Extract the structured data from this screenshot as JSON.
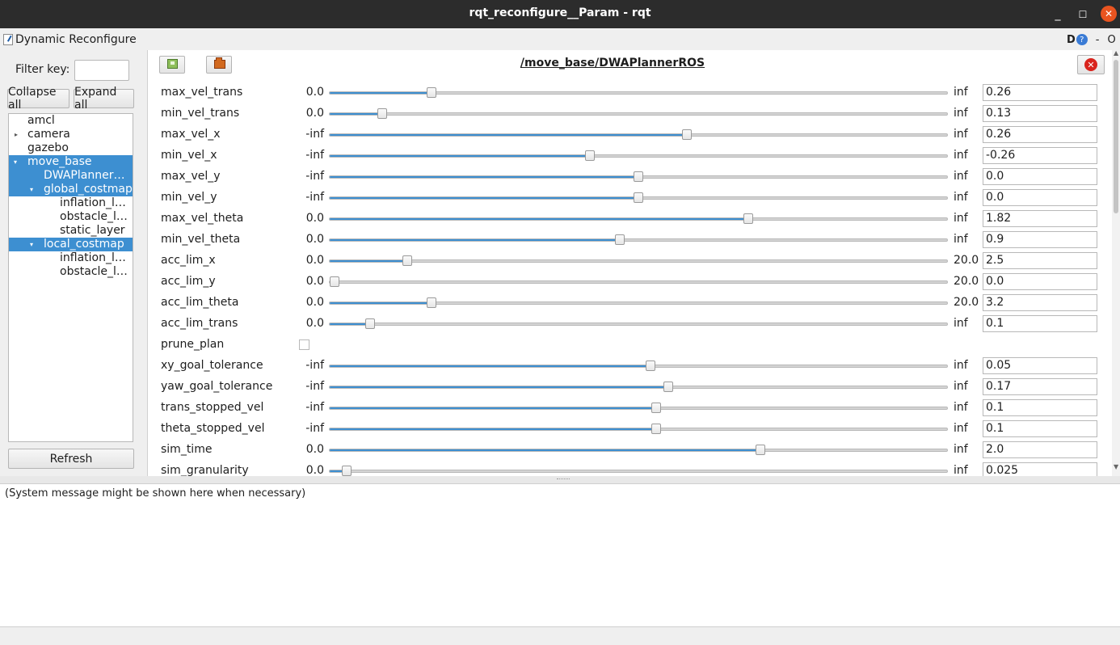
{
  "window": {
    "title": "rqt_reconfigure__Param - rqt",
    "minimize": "_",
    "maximize": "☐",
    "close": "✕"
  },
  "plugin": {
    "title": "Dynamic Reconfigure",
    "d_label": "D",
    "help": "?",
    "dash": "-",
    "c": "O"
  },
  "filter": {
    "label": "Filter key:",
    "value": ""
  },
  "buttons": {
    "collapse": "Collapse all",
    "expand": "Expand all",
    "refresh": "Refresh"
  },
  "tree": [
    {
      "label": "amcl",
      "arrow": "",
      "selected": false
    },
    {
      "label": "camera",
      "arrow": "▸",
      "selected": false
    },
    {
      "label": "gazebo",
      "arrow": "",
      "selected": false
    },
    {
      "label": "move_base",
      "arrow": "▾",
      "selected": true
    },
    {
      "label": "DWAPlanner…",
      "arrow": "",
      "selected": true
    },
    {
      "label": "global_costmap",
      "arrow": "▾",
      "selected": true
    },
    {
      "label": "inflation_l…",
      "arrow": "",
      "selected": false
    },
    {
      "label": "obstacle_l…",
      "arrow": "",
      "selected": false
    },
    {
      "label": "static_layer",
      "arrow": "",
      "selected": false
    },
    {
      "label": "local_costmap",
      "arrow": "▾",
      "selected": true
    },
    {
      "label": "inflation_l…",
      "arrow": "",
      "selected": false
    },
    {
      "label": "obstacle_l…",
      "arrow": "",
      "selected": false
    }
  ],
  "node": {
    "title": "/move_base/DWAPlannerROS",
    "close": "✕"
  },
  "params": [
    {
      "name": "max_vel_trans",
      "min": "0.0",
      "max": "inf",
      "value": "0.26",
      "slider": 0.165
    },
    {
      "name": "min_vel_trans",
      "min": "0.0",
      "max": "inf",
      "value": "0.13",
      "slider": 0.085
    },
    {
      "name": "max_vel_x",
      "min": "-inf",
      "max": "inf",
      "value": "0.26",
      "slider": 0.578
    },
    {
      "name": "min_vel_x",
      "min": "-inf",
      "max": "inf",
      "value": "-0.26",
      "slider": 0.421
    },
    {
      "name": "max_vel_y",
      "min": "-inf",
      "max": "inf",
      "value": "0.0",
      "slider": 0.5
    },
    {
      "name": "min_vel_y",
      "min": "-inf",
      "max": "inf",
      "value": "0.0",
      "slider": 0.5
    },
    {
      "name": "max_vel_theta",
      "min": "0.0",
      "max": "inf",
      "value": "1.82",
      "slider": 0.678
    },
    {
      "name": "min_vel_theta",
      "min": "0.0",
      "max": "inf",
      "value": "0.9",
      "slider": 0.47
    },
    {
      "name": "acc_lim_x",
      "min": "0.0",
      "max": "20.0",
      "value": "2.5",
      "slider": 0.125
    },
    {
      "name": "acc_lim_y",
      "min": "0.0",
      "max": "20.0",
      "value": "0.0",
      "slider": 0.0
    },
    {
      "name": "acc_lim_theta",
      "min": "0.0",
      "max": "20.0",
      "value": "3.2",
      "slider": 0.165
    },
    {
      "name": "acc_lim_trans",
      "min": "0.0",
      "max": "inf",
      "value": "0.1",
      "slider": 0.066
    },
    {
      "name": "prune_plan",
      "type": "bool",
      "checked": false
    },
    {
      "name": "xy_goal_tolerance",
      "min": "-inf",
      "max": "inf",
      "value": "0.05",
      "slider": 0.519
    },
    {
      "name": "yaw_goal_tolerance",
      "min": "-inf",
      "max": "inf",
      "value": "0.17",
      "slider": 0.549
    },
    {
      "name": "trans_stopped_vel",
      "min": "-inf",
      "max": "inf",
      "value": "0.1",
      "slider": 0.529
    },
    {
      "name": "theta_stopped_vel",
      "min": "-inf",
      "max": "inf",
      "value": "0.1",
      "slider": 0.529
    },
    {
      "name": "sim_time",
      "min": "0.0",
      "max": "inf",
      "value": "2.0",
      "slider": 0.697
    },
    {
      "name": "sim_granularity",
      "min": "0.0",
      "max": "inf",
      "value": "0.025",
      "slider": 0.027
    }
  ],
  "system_message": "(System message might be shown here when necessary)",
  "colors": {
    "accent": "#3d8fd1",
    "titlebar": "#2c2c2c",
    "close": "#e95420"
  }
}
